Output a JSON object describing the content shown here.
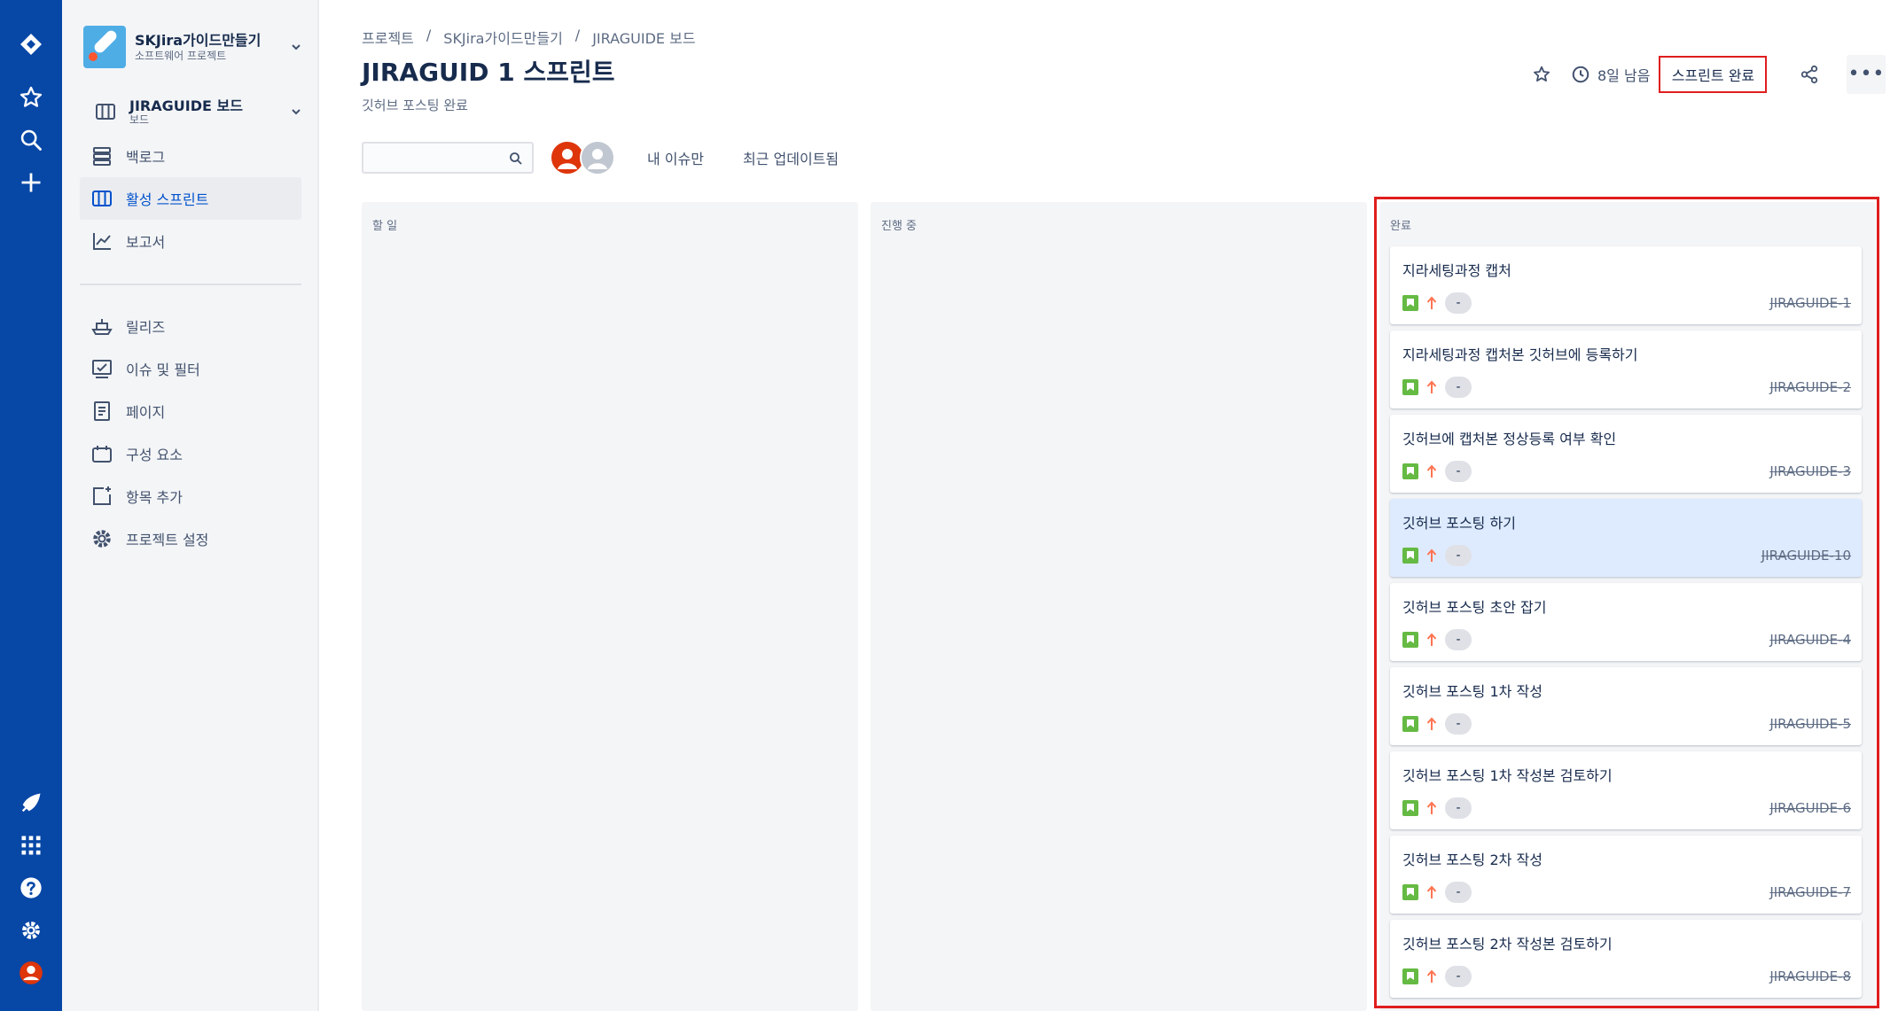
{
  "project": {
    "name": "SKJira가이드만들기",
    "type": "소프트웨어 프로젝트",
    "board_name": "JIRAGUIDE 보드",
    "board_type": "보드"
  },
  "sidebar": {
    "items": [
      {
        "label": "백로그",
        "icon": "backlog-icon"
      },
      {
        "label": "활성 스프린트",
        "icon": "board-icon",
        "active": true
      },
      {
        "label": "보고서",
        "icon": "reports-icon"
      },
      {
        "label": "릴리즈",
        "icon": "ship-icon"
      },
      {
        "label": "이슈 및 필터",
        "icon": "issues-icon"
      },
      {
        "label": "페이지",
        "icon": "page-icon"
      },
      {
        "label": "구성 요소",
        "icon": "components-icon"
      },
      {
        "label": "항목 추가",
        "icon": "add-item-icon"
      },
      {
        "label": "프로젝트 설정",
        "icon": "settings-icon"
      }
    ]
  },
  "breadcrumb": {
    "items": [
      "프로젝트",
      "SKJira가이드만들기",
      "JIRAGUIDE 보드"
    ],
    "separator": "/"
  },
  "sprint": {
    "title": "JIRAGUID 1 스프린트",
    "goal": "깃허브 포스팅 완료",
    "remaining": "8일 남음",
    "complete_label": "스프린트 완료",
    "more_label": "•••"
  },
  "filters": {
    "search_placeholder": "",
    "only_my_issues": "내 이슈만",
    "recently_updated": "최근 업데이트됨"
  },
  "columns": [
    {
      "title": "할 일",
      "cards": []
    },
    {
      "title": "진행 중",
      "cards": []
    },
    {
      "title": "완료",
      "cards": [
        {
          "summary": "지라세팅과정 캡처",
          "key": "JIRAGUIDE-1",
          "estimate": "-"
        },
        {
          "summary": "지라세팅과정 캡처본 깃허브에 등록하기",
          "key": "JIRAGUIDE-2",
          "estimate": "-"
        },
        {
          "summary": "깃허브에 캡처본 정상등록 여부 확인",
          "key": "JIRAGUIDE-3",
          "estimate": "-"
        },
        {
          "summary": "깃허브 포스팅 하기",
          "key": "JIRAGUIDE-10",
          "estimate": "-",
          "selected": true
        },
        {
          "summary": "깃허브 포스팅 초안 잡기",
          "key": "JIRAGUIDE-4",
          "estimate": "-"
        },
        {
          "summary": "깃허브 포스팅 1차 작성",
          "key": "JIRAGUIDE-5",
          "estimate": "-"
        },
        {
          "summary": "깃허브 포스팅 1차 작성본 검토하기",
          "key": "JIRAGUIDE-6",
          "estimate": "-"
        },
        {
          "summary": "깃허브 포스팅 2차 작성",
          "key": "JIRAGUIDE-7",
          "estimate": "-"
        },
        {
          "summary": "깃허브 포스팅 2차 작성본 검토하기",
          "key": "JIRAGUIDE-8",
          "estimate": "-"
        }
      ]
    }
  ],
  "colors": {
    "global_nav": "#0747a6",
    "accent": "#0052cc",
    "highlight_border": "#e01e1e",
    "story": "#65ba43",
    "priority_high": "#ff7452"
  }
}
